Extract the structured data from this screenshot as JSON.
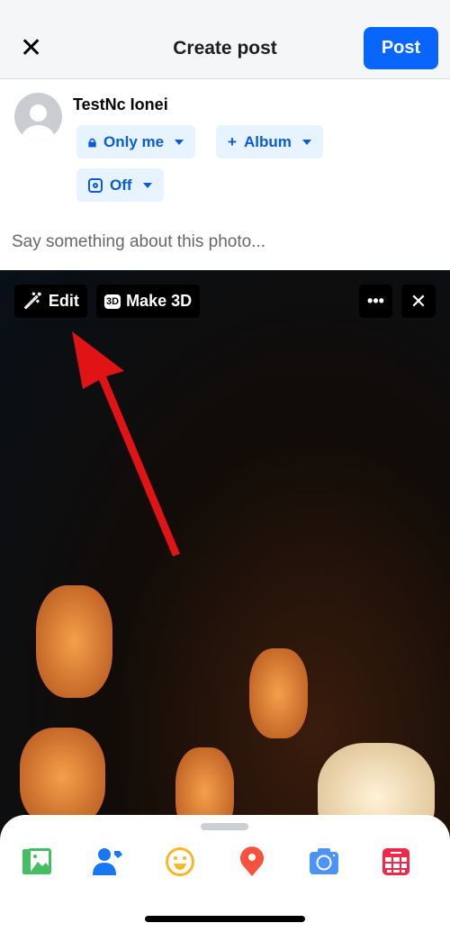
{
  "header": {
    "title": "Create post",
    "post_label": "Post",
    "close_icon": "close-icon"
  },
  "user": {
    "name": "TestNc Ionei"
  },
  "chips": {
    "privacy": "Only me",
    "album": "Album",
    "instagram": "Off"
  },
  "composer": {
    "placeholder": "Say something about this photo..."
  },
  "photo_toolbar": {
    "edit": "Edit",
    "make3d": "Make 3D",
    "make3d_badge": "3D"
  },
  "bottom_icons": [
    "photo-icon",
    "tag-people-icon",
    "feeling-icon",
    "location-icon",
    "camera-icon",
    "event-icon"
  ],
  "colors": {
    "accent": "#0866ff",
    "chip_bg": "#e7f3ff"
  }
}
